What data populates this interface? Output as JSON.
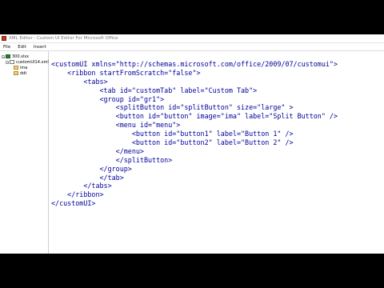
{
  "window": {
    "title": "XML Editor - Custom UI Editor For Microsoft Office"
  },
  "menu": {
    "items": [
      "File",
      "Edit",
      "Insert"
    ]
  },
  "tree": {
    "items": [
      {
        "label": "300.xlsx",
        "icon": "document-icon"
      },
      {
        "label": "customUI14.xml",
        "icon": "xml-file-icon"
      },
      {
        "label": "ima",
        "icon": "image-icon"
      },
      {
        "label": "ddt",
        "icon": "image-icon"
      }
    ]
  },
  "editor": {
    "lines": [
      "<customUI xmlns=\"http://schemas.microsoft.com/office/2009/07/customui\">",
      "    <ribbon startFromScratch=\"false\">",
      "        <tabs>",
      "            <tab id=\"customTab\" label=\"Custom Tab\">",
      "            <group id=\"gr1\">",
      "                <splitButton id=\"splitButton\" size=\"large\" >",
      "                <button id=\"button\" image=\"ima\" label=\"Split Button\" />",
      "                <menu id=\"menu\">",
      "                    <button id=\"button1\" label=\"Button 1\" />",
      "                    <button id=\"button2\" label=\"Button 2\" />",
      "                </menu>",
      "                </splitButton>",
      "            </group>",
      "            </tab>",
      "        </tabs>",
      "    </ribbon>",
      "</customUI>"
    ]
  }
}
